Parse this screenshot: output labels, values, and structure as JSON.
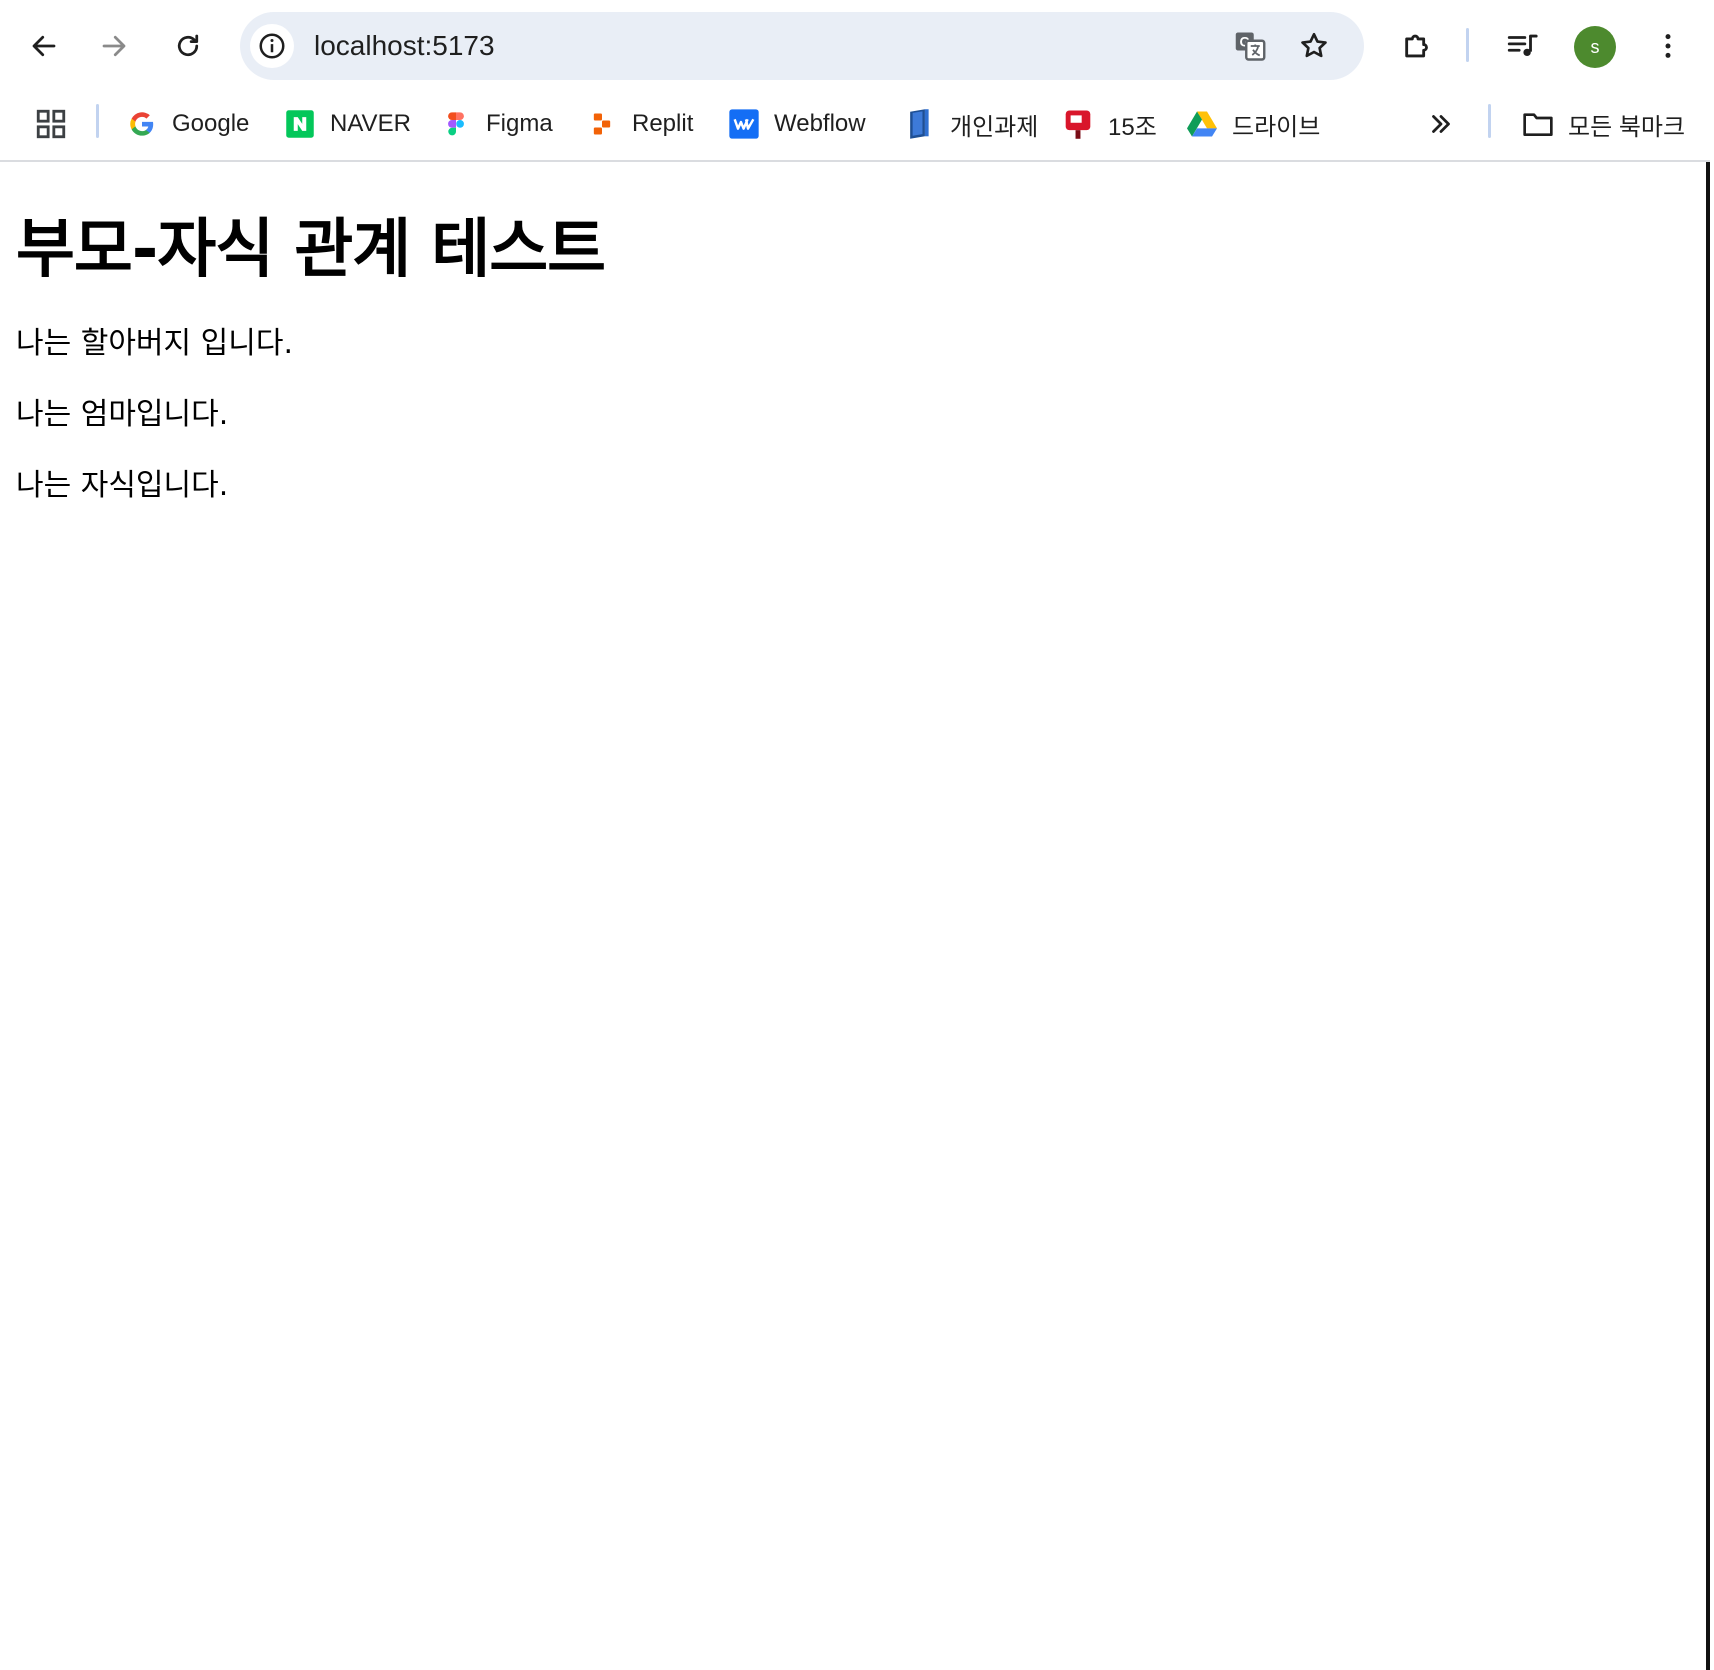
{
  "browser": {
    "url": "localhost:5173",
    "profile_initial": "s",
    "profile_color": "#4d8a2e",
    "icons": {
      "back": "arrow-left-icon",
      "forward": "arrow-right-icon",
      "reload": "reload-icon",
      "site_info": "info-icon",
      "translate": "translate-icon",
      "bookmark_star": "star-icon",
      "extensions": "puzzle-icon",
      "media": "media-queue-icon",
      "menu": "kebab-menu-icon"
    }
  },
  "bookmarks": {
    "items": [
      {
        "label": "Google",
        "icon": "google-icon"
      },
      {
        "label": "NAVER",
        "icon": "naver-icon"
      },
      {
        "label": "Figma",
        "icon": "figma-icon"
      },
      {
        "label": "Replit",
        "icon": "replit-icon"
      },
      {
        "label": "Webflow",
        "icon": "webflow-icon"
      },
      {
        "label": "개인과제",
        "icon": "book-icon"
      },
      {
        "label": "15조",
        "icon": "mailbox-icon"
      },
      {
        "label": "드라이브",
        "icon": "drive-icon"
      }
    ],
    "all_bookmarks_label": "모든 북마크"
  },
  "page": {
    "title": "부모-자식 관계 테스트",
    "paragraphs": [
      "나는 할아버지 입니다.",
      "나는 엄마입니다.",
      "나는 자식입니다."
    ]
  }
}
